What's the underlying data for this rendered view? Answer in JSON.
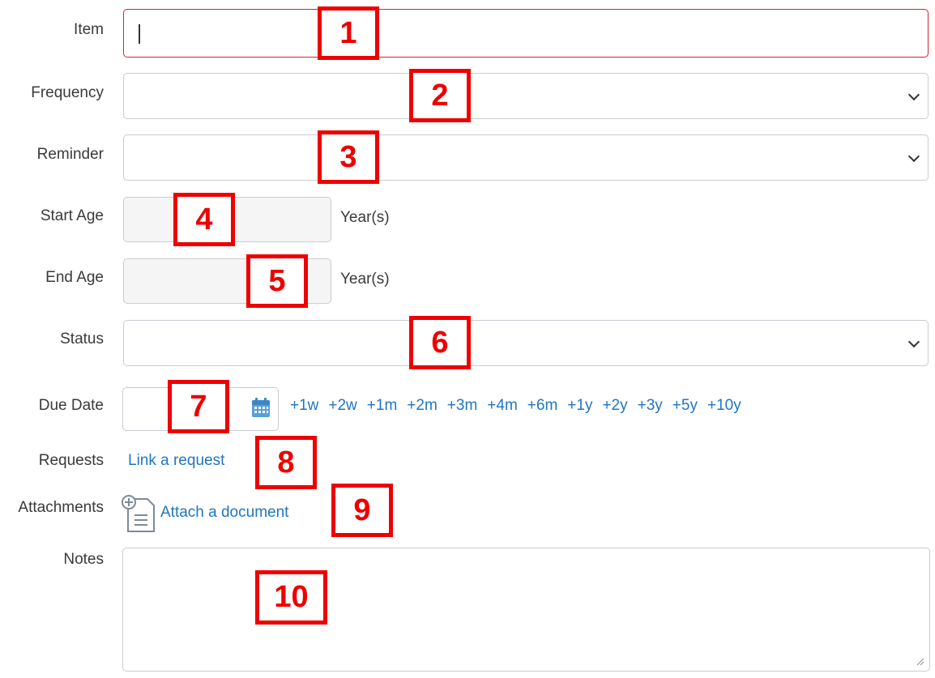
{
  "fields": {
    "item": {
      "label": "Item",
      "value": ""
    },
    "frequency": {
      "label": "Frequency",
      "value": ""
    },
    "reminder": {
      "label": "Reminder",
      "value": ""
    },
    "start_age": {
      "label": "Start Age",
      "value": "",
      "unit": "Year(s)"
    },
    "end_age": {
      "label": "End Age",
      "value": "",
      "unit": "Year(s)"
    },
    "status": {
      "label": "Status",
      "value": ""
    },
    "due_date": {
      "label": "Due Date",
      "value": "",
      "quick_add": [
        "+1w",
        "+2w",
        "+1m",
        "+2m",
        "+3m",
        "+4m",
        "+6m",
        "+1y",
        "+2y",
        "+3y",
        "+5y",
        "+10y"
      ]
    },
    "requests": {
      "label": "Requests",
      "link_text": "Link a request"
    },
    "attachments": {
      "label": "Attachments",
      "link_text": "Attach a document"
    },
    "notes": {
      "label": "Notes",
      "value": ""
    }
  },
  "callouts": [
    "1",
    "2",
    "3",
    "4",
    "5",
    "6",
    "7",
    "8",
    "9",
    "10"
  ],
  "icons": {
    "calendar": "calendar-icon",
    "attach": "attach-document-icon",
    "dropdown": "chevron-down-icon"
  },
  "colors": {
    "link": "#1f76c2",
    "error_border": "#cc2a2a",
    "callout": "#ee0000"
  }
}
